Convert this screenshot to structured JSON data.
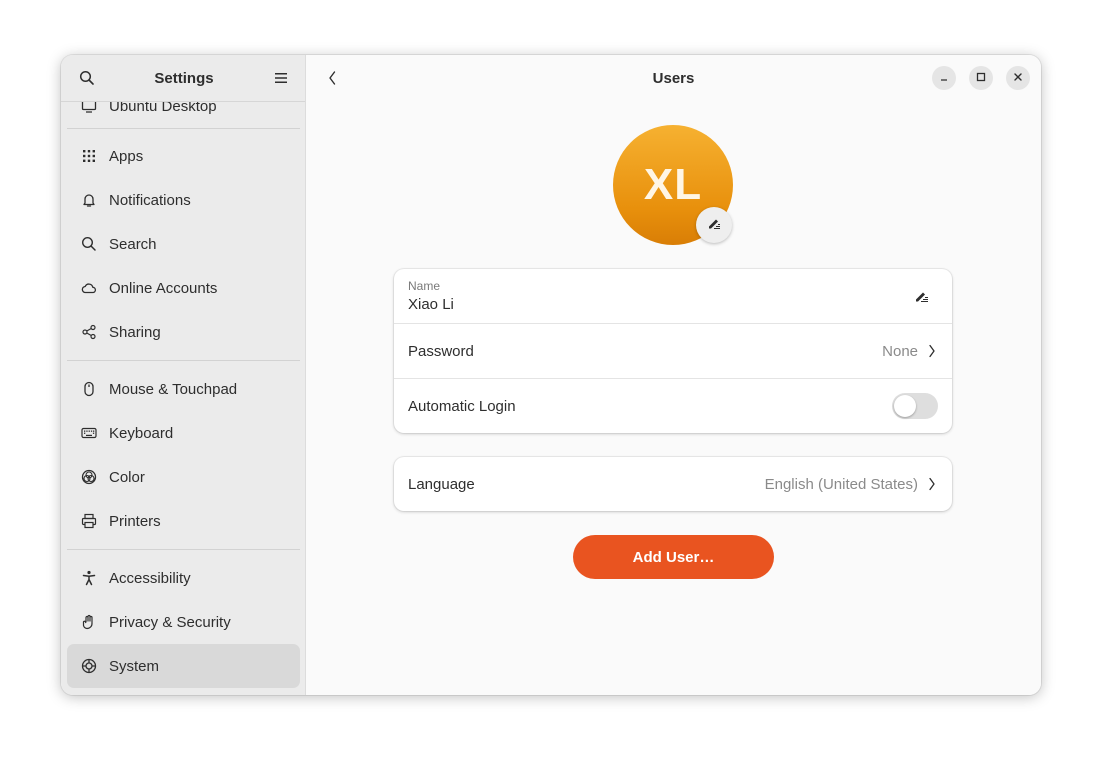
{
  "sidebar": {
    "title": "Settings",
    "cut_item": "Ubuntu Desktop",
    "groups": [
      [
        {
          "label": "Apps",
          "icon": "apps-grid-icon"
        },
        {
          "label": "Notifications",
          "icon": "bell-icon"
        },
        {
          "label": "Search",
          "icon": "search-icon"
        },
        {
          "label": "Online Accounts",
          "icon": "cloud-icon"
        },
        {
          "label": "Sharing",
          "icon": "share-icon"
        }
      ],
      [
        {
          "label": "Mouse & Touchpad",
          "icon": "mouse-icon"
        },
        {
          "label": "Keyboard",
          "icon": "keyboard-icon"
        },
        {
          "label": "Color",
          "icon": "color-icon"
        },
        {
          "label": "Printers",
          "icon": "printer-icon"
        }
      ],
      [
        {
          "label": "Accessibility",
          "icon": "accessibility-icon"
        },
        {
          "label": "Privacy & Security",
          "icon": "hand-icon"
        },
        {
          "label": "System",
          "icon": "system-gear-icon",
          "selected": true
        }
      ]
    ]
  },
  "content": {
    "title": "Users",
    "avatar_initials": "XL",
    "avatar_colors": [
      "#f6b131",
      "#d97e06"
    ],
    "account_card": {
      "name_caption": "Name",
      "name_value": "Xiao Li",
      "password_label": "Password",
      "password_value": "None",
      "autologin_label": "Automatic Login",
      "autologin_enabled": false
    },
    "language_card": {
      "label": "Language",
      "value": "English (United States)"
    },
    "add_user_label": "Add User…",
    "accent_color": "#e95420"
  }
}
